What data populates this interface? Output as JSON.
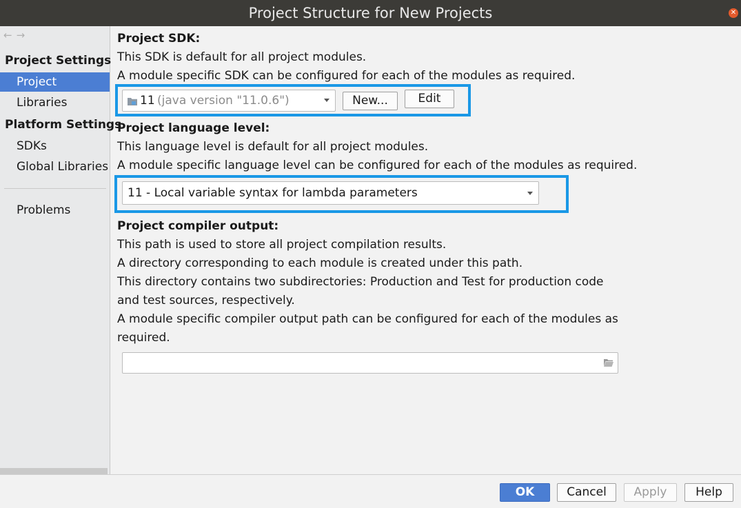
{
  "window": {
    "title": "Project Structure for New Projects"
  },
  "sidebar": {
    "back_glyph": "←",
    "forward_glyph": "→",
    "project_settings_heading": "Project Settings",
    "project_item": "Project",
    "libraries_item": "Libraries",
    "platform_settings_heading": "Platform Settings",
    "sdks_item": "SDKs",
    "global_libraries_item": "Global Libraries",
    "problems_item": "Problems"
  },
  "sdk": {
    "heading": "Project SDK:",
    "desc1": "This SDK is default for all project modules.",
    "desc2": "A module specific SDK can be configured for each of the modules as required.",
    "selected_name": "11",
    "selected_detail": "(java version \"11.0.6\")",
    "new_button": "New...",
    "edit_button": "Edit"
  },
  "language": {
    "heading": "Project language level:",
    "desc1": "This language level is default for all project modules.",
    "desc2": "A module specific language level can be configured for each of the modules as required.",
    "selected": "11 - Local variable syntax for lambda parameters"
  },
  "compiler": {
    "heading": "Project compiler output:",
    "line1": "This path is used to store all project compilation results.",
    "line2": "A directory corresponding to each module is created under this path.",
    "line3": "This directory contains two subdirectories: Production and Test for production code",
    "line4": "and test sources, respectively.",
    "line5": "A module specific compiler output path can be configured for each of the modules as",
    "line6": "required.",
    "path_value": ""
  },
  "footer": {
    "ok": "OK",
    "cancel": "Cancel",
    "apply": "Apply",
    "help": "Help"
  },
  "colors": {
    "accent": "#4b7ed3",
    "highlight": "#1a98e6",
    "titlebar": "#3c3b37"
  }
}
